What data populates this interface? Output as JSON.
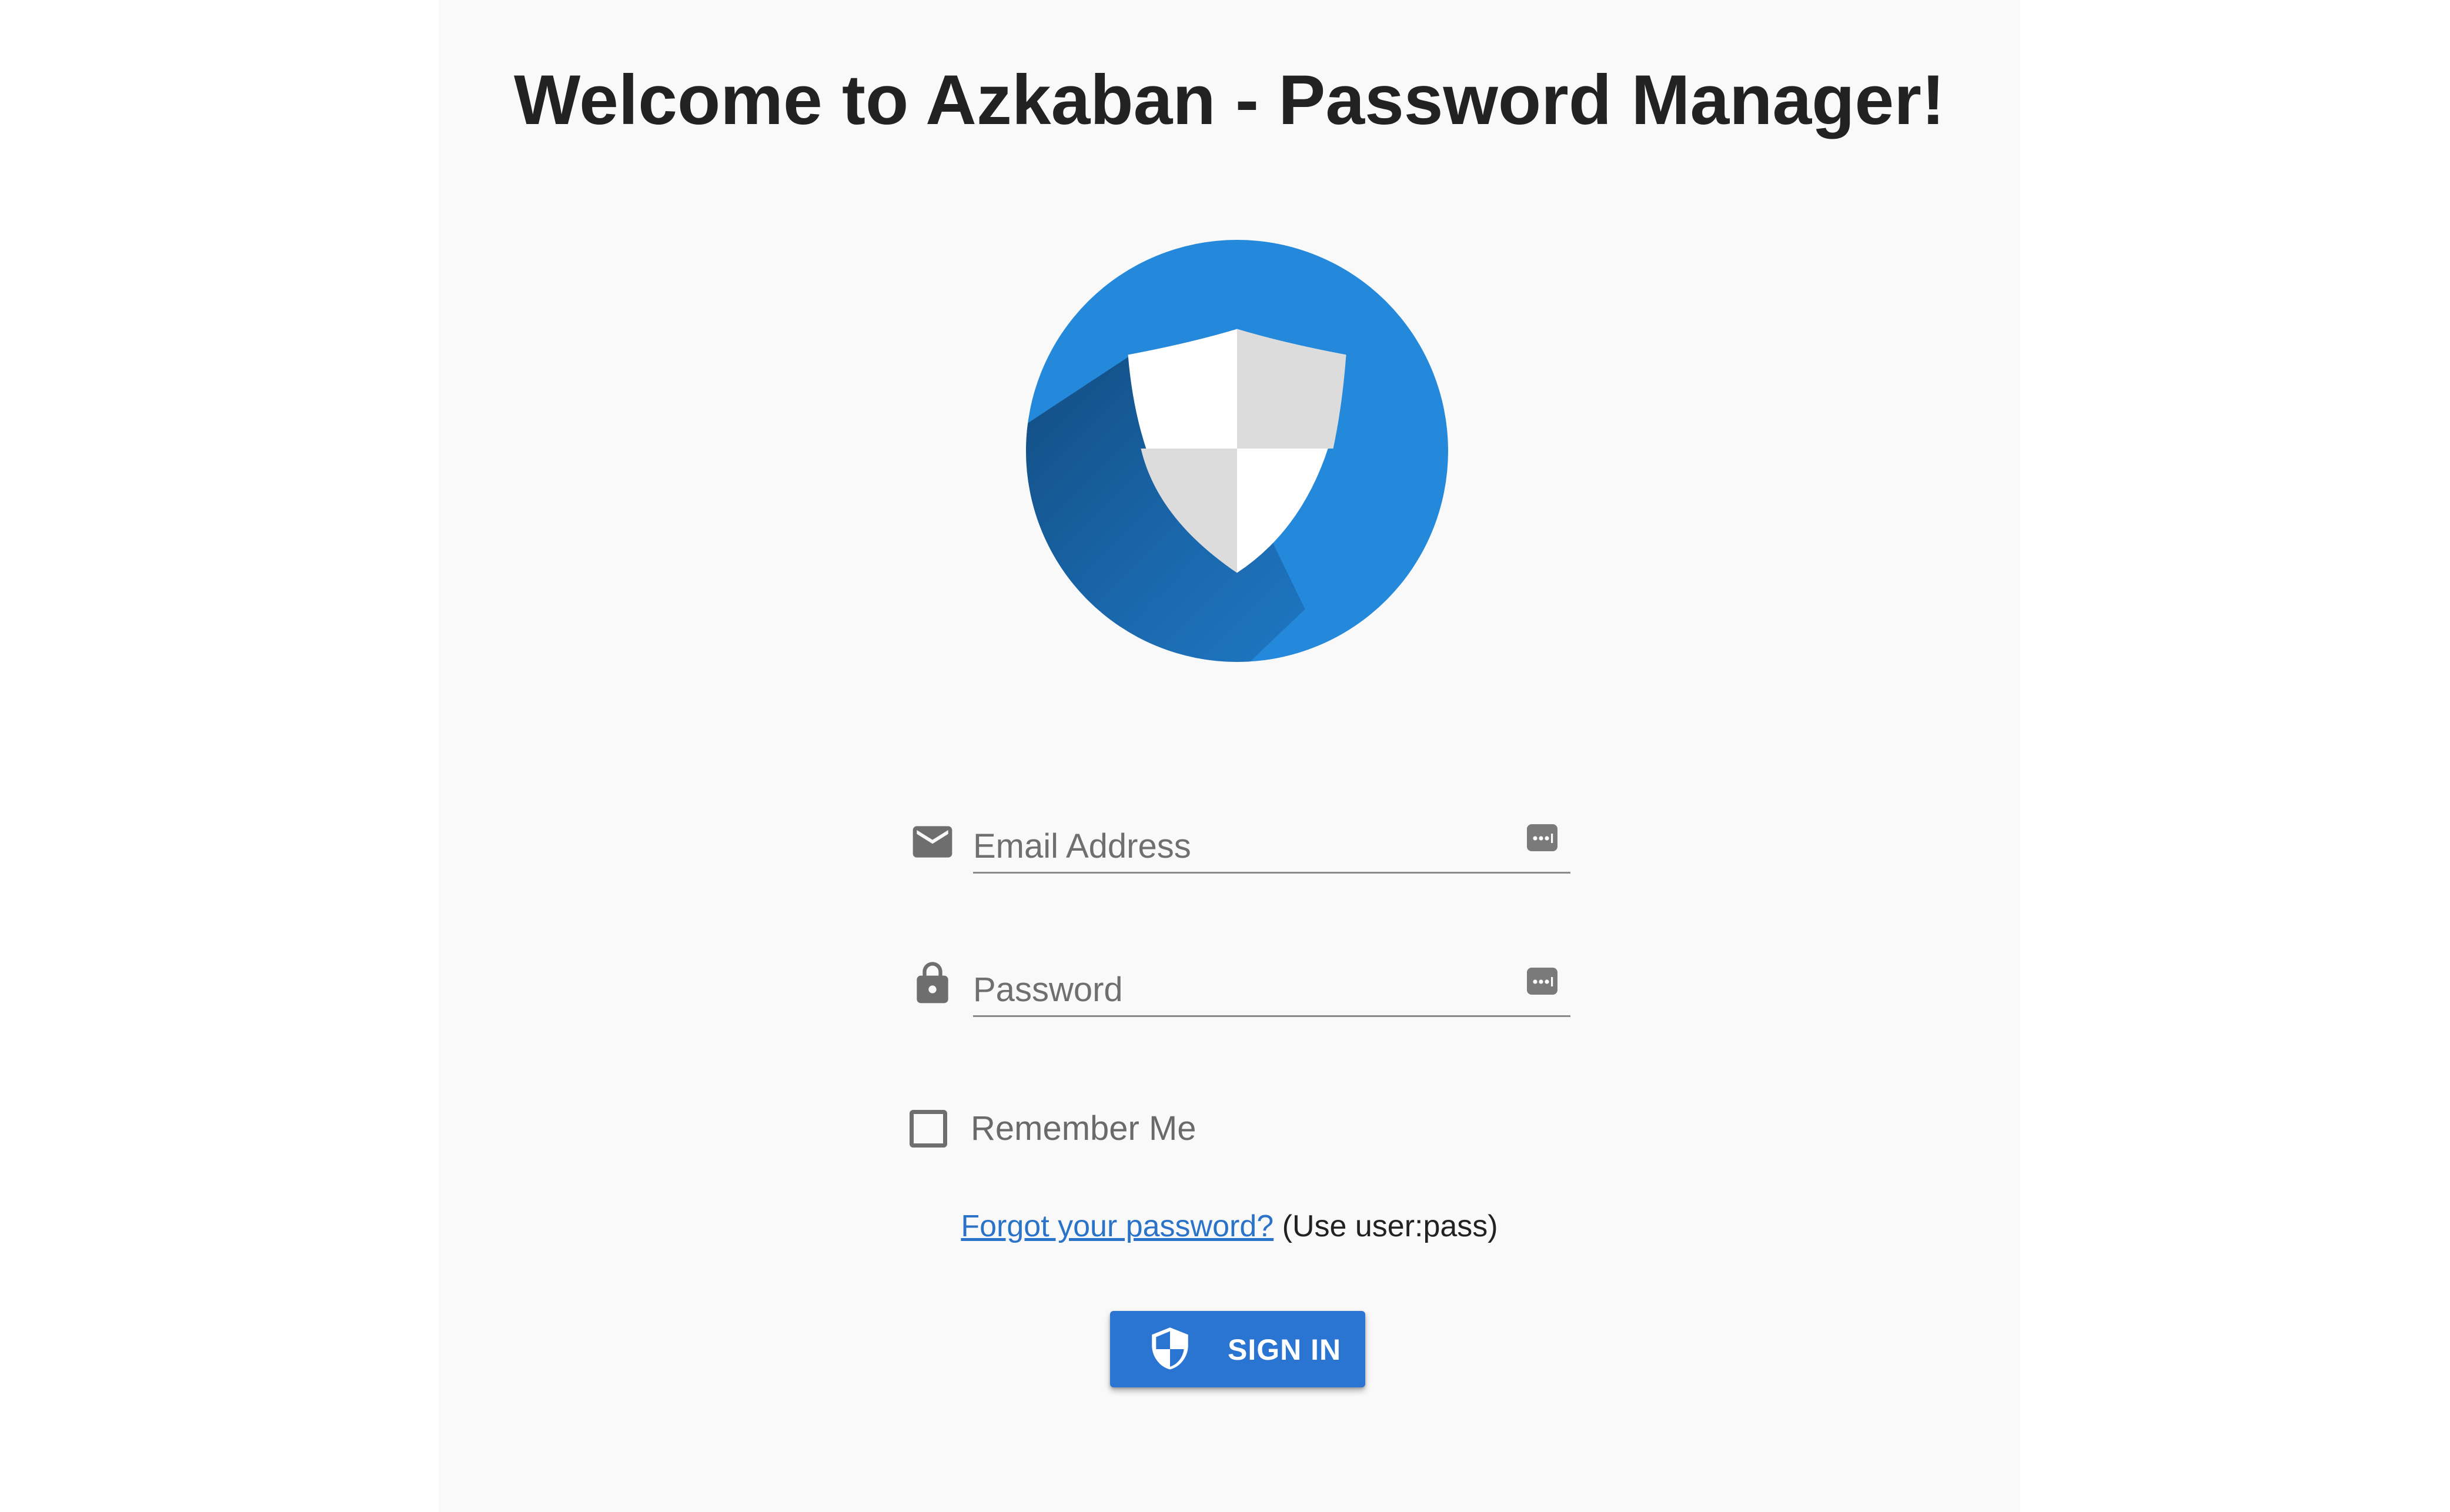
{
  "header": {
    "title": "Welcome to Azkaban - Password Manager!"
  },
  "logo": {
    "icon": "shield-logo-icon",
    "brand_color": "#2489db"
  },
  "login_form": {
    "email": {
      "icon": "mail-icon",
      "placeholder": "Email Address",
      "value": ""
    },
    "password": {
      "icon": "lock-icon",
      "placeholder": "Password",
      "value": ""
    },
    "password_manager_icon": "password-manager-icon",
    "remember_me": {
      "label": "Remember Me",
      "checked": false
    },
    "forgot": {
      "link_text": "Forgot your password?",
      "hint": "(Use user:pass)"
    },
    "sign_in": {
      "label": "SIGN IN",
      "icon": "shield-icon",
      "color": "#2a74d2"
    }
  },
  "colors": {
    "page_background": "#f9f9f9",
    "link": "#2a73c8",
    "icon_grey": "#6e6e6e"
  }
}
